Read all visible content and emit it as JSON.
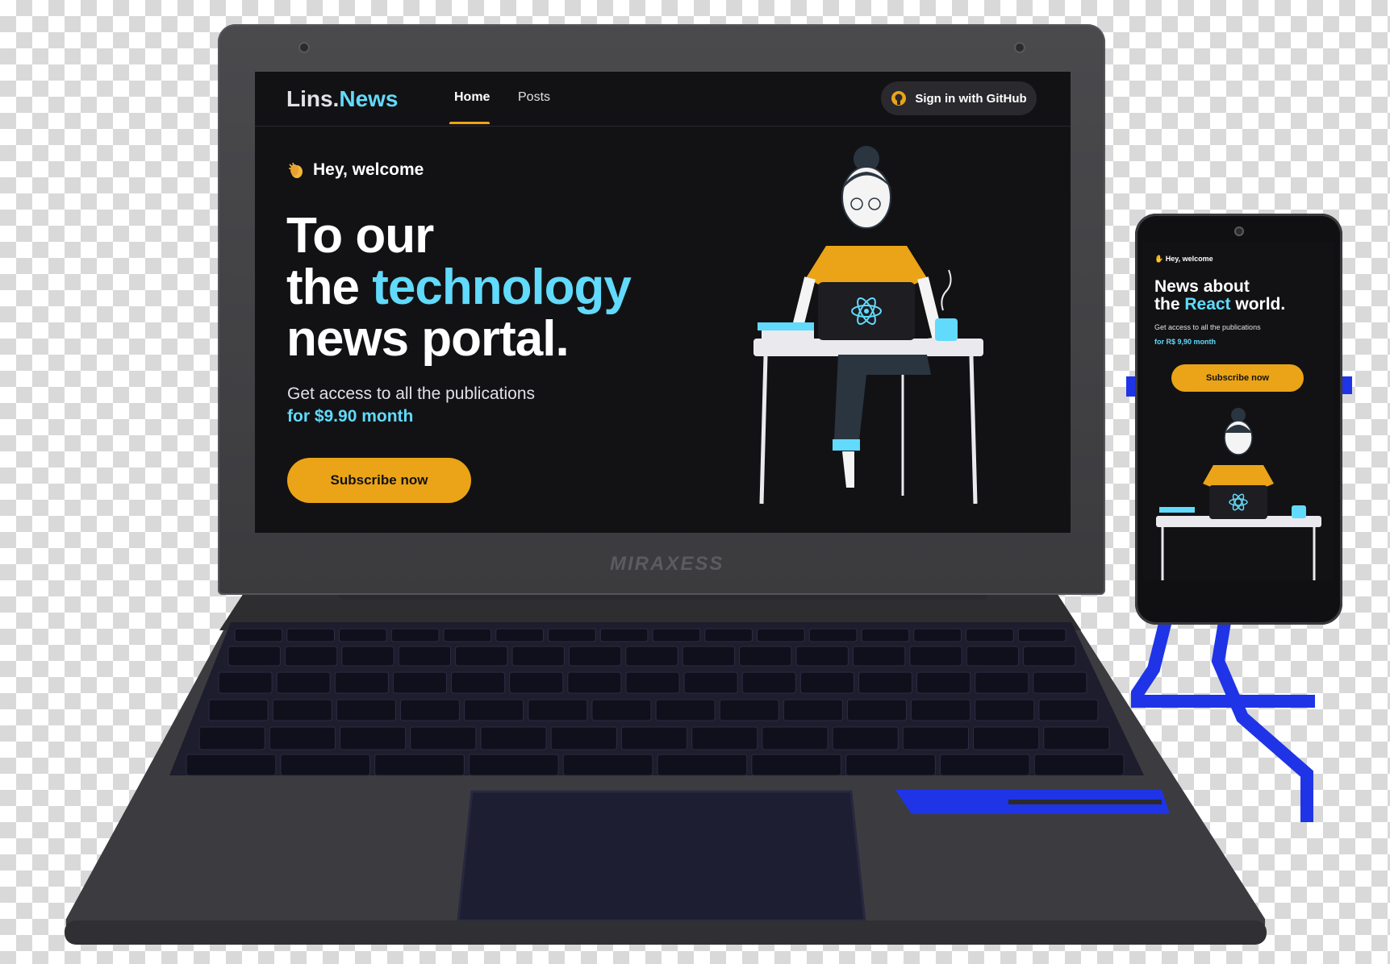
{
  "laptop": {
    "brand": "MIRAXESS",
    "site": {
      "logo": {
        "main": "Lins.",
        "accent": "News"
      },
      "nav": {
        "home": "Home",
        "posts": "Posts"
      },
      "github_button": "Sign in with GitHub",
      "hero": {
        "greeting": "Hey, welcome",
        "headline_line1": "To our",
        "headline_line2_prefix": "the ",
        "headline_line2_accent": "technology",
        "headline_line3": "news portal.",
        "subtitle": "Get access to all the publications",
        "price": "for $9.90 month",
        "cta": "Subscribe now"
      }
    }
  },
  "phone": {
    "greeting": "Hey, welcome",
    "headline_line1": "News about",
    "headline_line2_prefix": "the ",
    "headline_line2_accent": "React",
    "headline_line2_suffix": " world.",
    "subtitle": "Get access to all the publications",
    "price": "for R$ 9,90 month",
    "cta": "Subscribe now"
  },
  "colors": {
    "background": "#121214",
    "accent_blue": "#61dafb",
    "accent_yellow": "#eba417",
    "text": "#e1e1e6"
  },
  "icons": [
    "github-icon",
    "clapping-hands-icon",
    "react-logo-icon"
  ]
}
